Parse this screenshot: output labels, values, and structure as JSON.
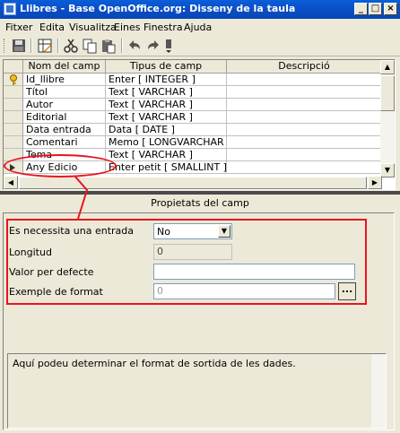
{
  "window": {
    "title": "Llibres - Base OpenOffice.org: Disseny de la taula",
    "min_label": "_",
    "max_label": "□",
    "close_label": "×"
  },
  "menu": [
    {
      "label": "Fitxer"
    },
    {
      "label": "Edita"
    },
    {
      "label": "Visualitza"
    },
    {
      "label": "Eines"
    },
    {
      "label": "Finestra"
    },
    {
      "label": "Ajuda"
    }
  ],
  "toolbar": {
    "icons": [
      "save-icon",
      "table-design-icon",
      "cut-icon",
      "copy-icon",
      "paste-icon",
      "undo-icon",
      "redo-icon",
      "toolbar-overflow-icon"
    ]
  },
  "table": {
    "headers": {
      "field_name": "Nom del camp",
      "field_type": "Tipus de camp",
      "description": "Descripció"
    },
    "rows": [
      {
        "name": "Id_llibre",
        "type": "Enter [ INTEGER ]",
        "description": "",
        "primary_key": true
      },
      {
        "name": "Títol",
        "type": "Text [ VARCHAR ]",
        "description": ""
      },
      {
        "name": "Autor",
        "type": "Text [ VARCHAR ]",
        "description": ""
      },
      {
        "name": "Editorial",
        "type": "Text [ VARCHAR ]",
        "description": ""
      },
      {
        "name": "Data entrada",
        "type": "Data [ DATE ]",
        "description": ""
      },
      {
        "name": "Comentari",
        "type": "Memo [ LONGVARCHAR ]",
        "description": ""
      },
      {
        "name": "Tema",
        "type": "Text [ VARCHAR ]",
        "description": ""
      },
      {
        "name": "Any Edicio",
        "type": "Enter petit [ SMALLINT ]",
        "description": "",
        "selected": true
      }
    ]
  },
  "properties": {
    "title": "Propietats del camp",
    "required_label": "Es necessita una entrada",
    "required_value": "No",
    "length_label": "Longitud",
    "length_value": "0",
    "default_label": "Valor per defecte",
    "default_value": "",
    "format_label": "Exemple de format",
    "format_value": "0",
    "format_button": "...",
    "help_text": "Aquí podeu determinar el format de sortida de les dades."
  },
  "colors": {
    "annotation": "#e8141e",
    "titlebar": "#0a50c7"
  }
}
